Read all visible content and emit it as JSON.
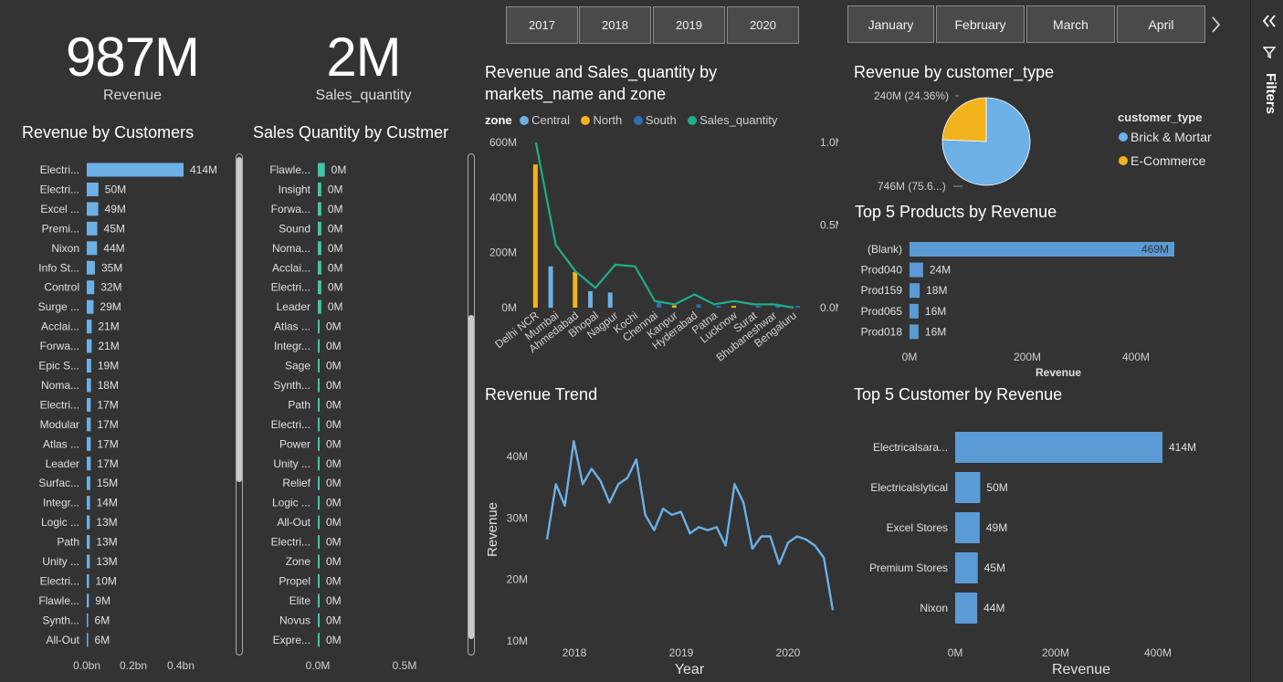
{
  "kpis": {
    "revenue": {
      "value": "987M",
      "label": "Revenue"
    },
    "sales_quantity": {
      "value": "2M",
      "label": "Sales_quantity"
    }
  },
  "year_slicer": [
    "2017",
    "2018",
    "2019",
    "2020"
  ],
  "month_slicer": [
    "January",
    "February",
    "March",
    "April"
  ],
  "filters_label": "Filters",
  "colors": {
    "background": "#333333",
    "central": "#6cb0e6",
    "north": "#f2b31c",
    "south": "#2f6fb5",
    "sales_quantity": "#1fae88",
    "bar_blue": "#5b9bd5",
    "teal": "#3ec8a8"
  },
  "chart_data": [
    {
      "id": "revenue_by_customers",
      "type": "bar",
      "orientation": "horizontal",
      "title": "Revenue by Customers",
      "categories": [
        "Electri...",
        "Electri...",
        "Excel ...",
        "Premi...",
        "Nixon",
        "Info St...",
        "Control",
        "Surge ...",
        "Acclai...",
        "Forwa...",
        "Epic S...",
        "Noma...",
        "Electri...",
        "Modular",
        "Atlas ...",
        "Leader",
        "Surfac...",
        "Integr...",
        "Logic ...",
        "Path",
        "Unity ...",
        "Electri...",
        "Flawle...",
        "Synth...",
        "All-Out"
      ],
      "values": [
        414,
        50,
        49,
        45,
        44,
        35,
        32,
        29,
        21,
        21,
        19,
        18,
        17,
        17,
        17,
        17,
        15,
        14,
        13,
        13,
        13,
        10,
        9,
        6,
        6
      ],
      "data_labels": [
        "414M",
        "50M",
        "49M",
        "45M",
        "44M",
        "35M",
        "32M",
        "29M",
        "21M",
        "21M",
        "19M",
        "18M",
        "17M",
        "17M",
        "17M",
        "17M",
        "15M",
        "14M",
        "13M",
        "13M",
        "13M",
        "10M",
        "9M",
        "6M",
        "6M"
      ],
      "x_ticks": [
        "0.0bn",
        "0.2bn",
        "0.4bn"
      ],
      "xlim": [
        0,
        460
      ]
    },
    {
      "id": "sales_quantity_by_customer",
      "type": "bar",
      "orientation": "horizontal",
      "title": "Sales Quantity by Custmer",
      "categories": [
        "Flawle...",
        "Insight",
        "Forwa...",
        "Sound",
        "Noma...",
        "Acclai...",
        "Electri...",
        "Leader",
        "Atlas ...",
        "Integr...",
        "Sage",
        "Synth...",
        "Path",
        "Electri...",
        "Power",
        "Unity ...",
        "Relief",
        "Logic ...",
        "All-Out",
        "Electri...",
        "Zone",
        "Propel",
        "Elite",
        "Novus",
        "Expre..."
      ],
      "values": [
        0.04,
        0.02,
        0.02,
        0.02,
        0.02,
        0.02,
        0.02,
        0.02,
        0.01,
        0.01,
        0.01,
        0.01,
        0.01,
        0.01,
        0.01,
        0.01,
        0.01,
        0.01,
        0.01,
        0.01,
        0.01,
        0.01,
        0.005,
        0.005,
        0.005
      ],
      "data_labels": [
        "0M",
        "0M",
        "0M",
        "0M",
        "0M",
        "0M",
        "0M",
        "0M",
        "0M",
        "0M",
        "0M",
        "0M",
        "0M",
        "0M",
        "0M",
        "0M",
        "0M",
        "0M",
        "0M",
        "0M",
        "0M",
        "0M",
        "0M",
        "0M",
        "0M"
      ],
      "x_ticks": [
        "0.0M",
        "0.5M"
      ],
      "xlim": [
        0,
        0.55
      ]
    },
    {
      "id": "revenue_sales_by_market",
      "type": "bar",
      "title_lines": [
        "Revenue and Sales_quantity by",
        "markets_name and zone"
      ],
      "legend_title": "zone",
      "legend": [
        "Central",
        "North",
        "South",
        "Sales_quantity"
      ],
      "categories": [
        "Delhi NCR",
        "Mumbai",
        "Ahmedabad",
        "Bhopal",
        "Nagpur",
        "Kochi",
        "Chennai",
        "Kanpur",
        "Hyderabad",
        "Patna",
        "Lucknow",
        "Surat",
        "Bhubaneshwar",
        "Bengaluru"
      ],
      "series": [
        {
          "name": "Central",
          "values": [
            0,
            150,
            0,
            60,
            55,
            0,
            0,
            0,
            0,
            0,
            0,
            0,
            0,
            0
          ]
        },
        {
          "name": "North",
          "values": [
            520,
            0,
            130,
            0,
            0,
            0,
            0,
            8,
            0,
            0,
            5,
            0,
            0,
            0
          ]
        },
        {
          "name": "South",
          "values": [
            0,
            0,
            0,
            0,
            0,
            0,
            18,
            0,
            12,
            6,
            0,
            3,
            3,
            2
          ]
        }
      ],
      "line_series": {
        "name": "Sales_quantity",
        "values": [
          1.0,
          0.38,
          0.22,
          0.12,
          0.26,
          0.25,
          0.04,
          0.02,
          0.08,
          0.02,
          0.04,
          0.02,
          0.02,
          0.0
        ]
      },
      "y_ticks_left": [
        "0M",
        "200M",
        "400M",
        "600M"
      ],
      "y_ticks_right": [
        "0.0M",
        "0.5M",
        "1.0M"
      ],
      "ylim_left": [
        0,
        600
      ],
      "ylim_right": [
        0,
        1.0
      ]
    },
    {
      "id": "revenue_by_customer_type",
      "type": "pie",
      "title": "Revenue by customer_type",
      "legend_title": "customer_type",
      "slices": [
        {
          "name": "Brick & Mortar",
          "value": 746,
          "label": "746M (75.6...)"
        },
        {
          "name": "E-Commerce",
          "value": 240,
          "label": "240M (24.36%)"
        }
      ]
    },
    {
      "id": "top5_products",
      "type": "bar",
      "orientation": "horizontal",
      "title": "Top 5 Products by Revenue",
      "categories": [
        "(Blank)",
        "Prod040",
        "Prod159",
        "Prod065",
        "Prod018"
      ],
      "values": [
        469,
        24,
        18,
        16,
        16
      ],
      "data_labels": [
        "469M",
        "24M",
        "18M",
        "16M",
        "16M"
      ],
      "x_ticks": [
        "0M",
        "200M",
        "400M"
      ],
      "xlabel": "Revenue",
      "xlim": [
        0,
        480
      ]
    },
    {
      "id": "revenue_trend",
      "type": "line",
      "title": "Revenue Trend",
      "xlabel": "Year",
      "ylabel": "Revenue",
      "x_ticks": [
        "2018",
        "2019",
        "2020"
      ],
      "y_ticks": [
        "10M",
        "20M",
        "30M",
        "40M"
      ],
      "ylim": [
        10,
        44
      ],
      "values": [
        26.5,
        35.5,
        32,
        42.5,
        35.5,
        38,
        36,
        32.5,
        35.5,
        36.5,
        39.5,
        30.5,
        28,
        31.5,
        30.5,
        31,
        27.5,
        28.5,
        28,
        28.5,
        25.5,
        35.5,
        32.5,
        25,
        27,
        27,
        22.5,
        26,
        27,
        26.5,
        25.5,
        23.5,
        15
      ]
    },
    {
      "id": "top5_customers",
      "type": "bar",
      "orientation": "horizontal",
      "title": "Top 5 Customer by Revenue",
      "categories": [
        "Electricalsara...",
        "Electricalslytical",
        "Excel Stores",
        "Premium Stores",
        "Nixon"
      ],
      "values": [
        414,
        50,
        49,
        45,
        44
      ],
      "data_labels": [
        "414M",
        "50M",
        "49M",
        "45M",
        "44M"
      ],
      "x_ticks": [
        "0M",
        "200M",
        "400M"
      ],
      "xlabel": "Revenue",
      "xlim": [
        0,
        420
      ]
    }
  ]
}
